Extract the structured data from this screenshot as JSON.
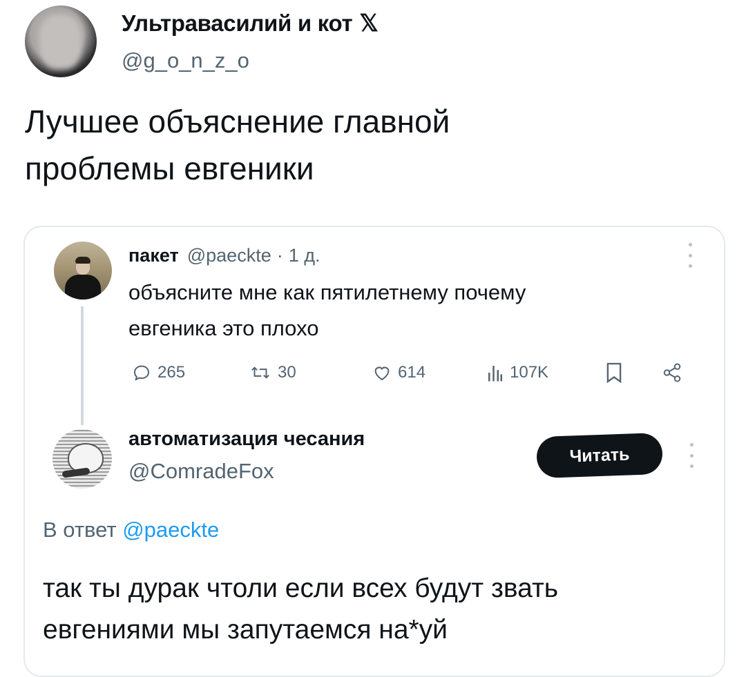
{
  "outer_post": {
    "author_name": "Ультравасилий и кот",
    "verified_icon": "x-logo-icon",
    "x_glyph": "𝕏",
    "handle": "@g_o_n_z_o",
    "text": "Лучшее объяснение главной\nпроблемы евгеники"
  },
  "quoted_post": {
    "author_name": "пакет",
    "handle": "@paeckte",
    "dot": "·",
    "time": "1 д.",
    "text": "объясните мне как пятилетнему почему\nевгеника это плохо",
    "actions": {
      "replies": "265",
      "retweets": "30",
      "likes": "614",
      "views": "107K"
    }
  },
  "reply_post": {
    "author_name": "автоматизация чесания",
    "handle": "@ComradeFox",
    "follow_label": "Читать",
    "reply_to_prefix": "В ответ ",
    "reply_to_handle": "@paeckte",
    "text": "так ты дурак чтоли если всех будут звать\nевгениями мы запутаемся на*уй"
  },
  "colors": {
    "text_primary": "#0f1419",
    "text_secondary": "#536471",
    "link": "#1d9bf0",
    "border": "#e6e9eb",
    "button_bg": "#0f1419"
  }
}
